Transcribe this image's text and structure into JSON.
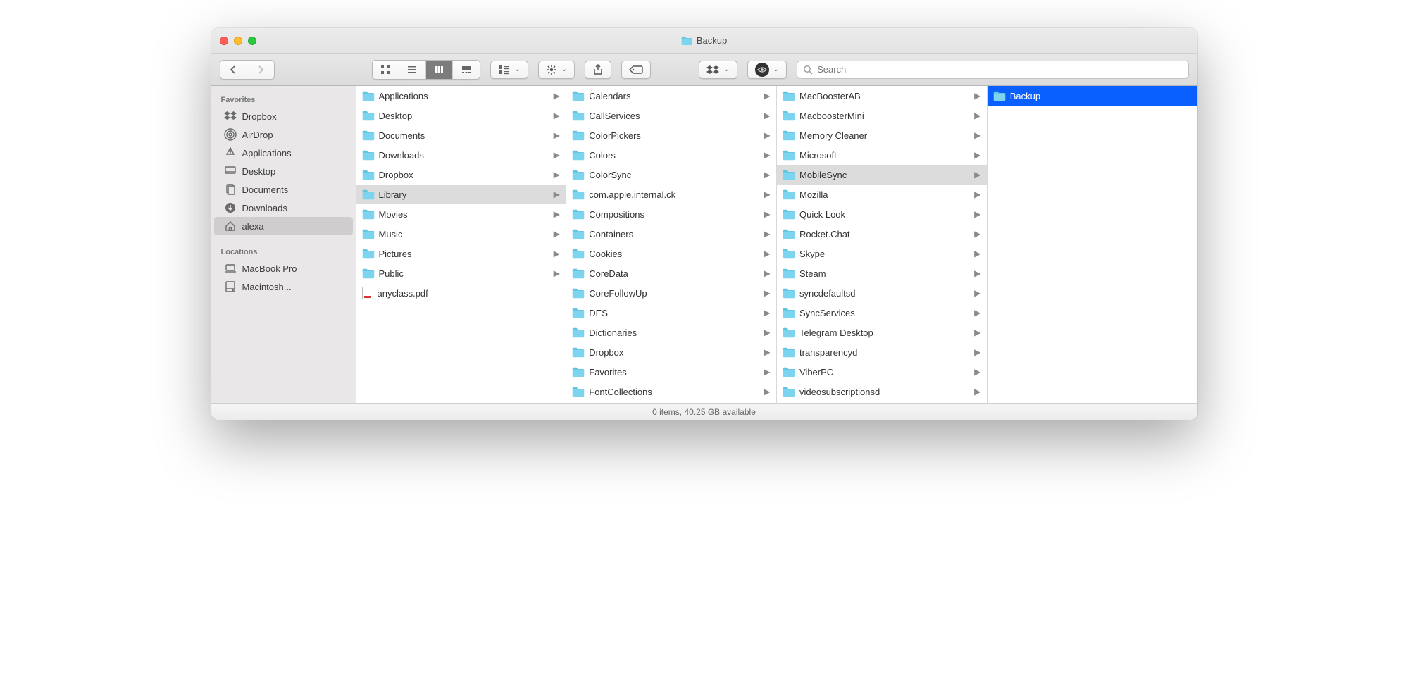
{
  "window": {
    "title": "Backup"
  },
  "toolbar": {
    "search_placeholder": "Search"
  },
  "sidebar": {
    "section1": {
      "heading": "Favorites",
      "items": [
        {
          "label": "Dropbox",
          "icon": "dropbox"
        },
        {
          "label": "AirDrop",
          "icon": "airdrop"
        },
        {
          "label": "Applications",
          "icon": "apps"
        },
        {
          "label": "Desktop",
          "icon": "desktop"
        },
        {
          "label": "Documents",
          "icon": "documents"
        },
        {
          "label": "Downloads",
          "icon": "downloads"
        },
        {
          "label": "alexa",
          "icon": "home",
          "selected": true
        }
      ]
    },
    "section2": {
      "heading": "Locations",
      "items": [
        {
          "label": "MacBook Pro",
          "icon": "laptop"
        },
        {
          "label": "Macintosh...",
          "icon": "disk"
        }
      ]
    }
  },
  "columns": [
    {
      "items": [
        {
          "label": "Applications",
          "kind": "folder",
          "children": true
        },
        {
          "label": "Desktop",
          "kind": "folder",
          "children": true
        },
        {
          "label": "Documents",
          "kind": "folder",
          "children": true
        },
        {
          "label": "Downloads",
          "kind": "folder",
          "children": true
        },
        {
          "label": "Dropbox",
          "kind": "folder",
          "children": true
        },
        {
          "label": "Library",
          "kind": "folder",
          "children": true,
          "selected": "path"
        },
        {
          "label": "Movies",
          "kind": "folder",
          "children": true
        },
        {
          "label": "Music",
          "kind": "folder",
          "children": true
        },
        {
          "label": "Pictures",
          "kind": "folder",
          "children": true
        },
        {
          "label": "Public",
          "kind": "folder",
          "children": true
        },
        {
          "label": "anyclass.pdf",
          "kind": "pdf",
          "children": false
        }
      ]
    },
    {
      "items": [
        {
          "label": "Calendars",
          "kind": "folder",
          "children": true
        },
        {
          "label": "CallServices",
          "kind": "folder",
          "children": true
        },
        {
          "label": "ColorPickers",
          "kind": "folder",
          "children": true
        },
        {
          "label": "Colors",
          "kind": "folder",
          "children": true
        },
        {
          "label": "ColorSync",
          "kind": "folder",
          "children": true
        },
        {
          "label": "com.apple.internal.ck",
          "kind": "folder",
          "children": true
        },
        {
          "label": "Compositions",
          "kind": "folder",
          "children": true
        },
        {
          "label": "Containers",
          "kind": "folder",
          "children": true
        },
        {
          "label": "Cookies",
          "kind": "folder",
          "children": true
        },
        {
          "label": "CoreData",
          "kind": "folder",
          "children": true
        },
        {
          "label": "CoreFollowUp",
          "kind": "folder",
          "children": true
        },
        {
          "label": "DES",
          "kind": "folder",
          "children": true
        },
        {
          "label": "Dictionaries",
          "kind": "folder",
          "children": true
        },
        {
          "label": "Dropbox",
          "kind": "folder",
          "children": true
        },
        {
          "label": "Favorites",
          "kind": "folder",
          "children": true
        },
        {
          "label": "FontCollections",
          "kind": "folder",
          "children": true
        }
      ]
    },
    {
      "items": [
        {
          "label": "MacBoosterAB",
          "kind": "folder",
          "children": true
        },
        {
          "label": "MacboosterMini",
          "kind": "folder",
          "children": true
        },
        {
          "label": "Memory Cleaner",
          "kind": "folder",
          "children": true
        },
        {
          "label": "Microsoft",
          "kind": "folder",
          "children": true
        },
        {
          "label": "MobileSync",
          "kind": "folder",
          "children": true,
          "selected": "path"
        },
        {
          "label": "Mozilla",
          "kind": "folder",
          "children": true
        },
        {
          "label": "Quick Look",
          "kind": "folder",
          "children": true
        },
        {
          "label": "Rocket.Chat",
          "kind": "folder",
          "children": true
        },
        {
          "label": "Skype",
          "kind": "folder",
          "children": true
        },
        {
          "label": "Steam",
          "kind": "folder",
          "children": true
        },
        {
          "label": "syncdefaultsd",
          "kind": "folder",
          "children": true
        },
        {
          "label": "SyncServices",
          "kind": "folder",
          "children": true
        },
        {
          "label": "Telegram Desktop",
          "kind": "folder",
          "children": true
        },
        {
          "label": "transparencyd",
          "kind": "folder",
          "children": true
        },
        {
          "label": "ViberPC",
          "kind": "folder",
          "children": true
        },
        {
          "label": "videosubscriptionsd",
          "kind": "folder",
          "children": true
        }
      ]
    },
    {
      "items": [
        {
          "label": "Backup",
          "kind": "folder",
          "children": false,
          "selected": "active"
        }
      ]
    }
  ],
  "status": {
    "text": "0 items, 40.25 GB available"
  }
}
